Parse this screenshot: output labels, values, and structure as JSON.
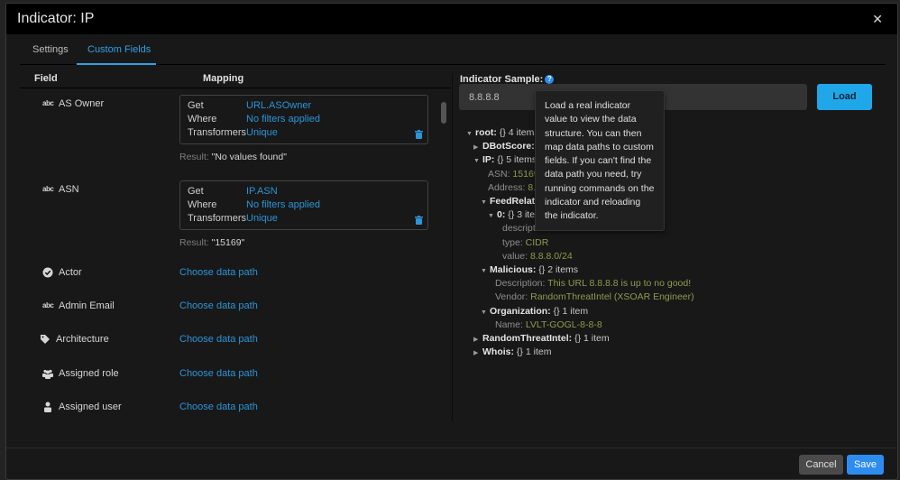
{
  "dialog": {
    "title": "Indicator: IP",
    "close_icon": "close-icon"
  },
  "tabs": [
    {
      "label": "Settings",
      "active": false
    },
    {
      "label": "Custom Fields",
      "active": true
    }
  ],
  "columns": {
    "field": "Field",
    "mapping": "Mapping"
  },
  "mapping_labels": {
    "get": "Get",
    "where": "Where",
    "transformers": "Transformers",
    "result": "Result:"
  },
  "fields": [
    {
      "name": "AS Owner",
      "icon": "text-type-icon",
      "mapped": true,
      "get": "URL.ASOwner",
      "where": "No filters applied",
      "transformers": "Unique",
      "result": "\"No values found\""
    },
    {
      "name": "ASN",
      "icon": "text-type-icon",
      "mapped": true,
      "get": "IP.ASN",
      "where": "No filters applied",
      "transformers": "Unique",
      "result": "\"15169\""
    },
    {
      "name": "Actor",
      "icon": "check-circle-icon",
      "mapped": false,
      "action": "Choose data path"
    },
    {
      "name": "Admin Email",
      "icon": "text-type-icon",
      "mapped": false,
      "action": "Choose data path"
    },
    {
      "name": "Architecture",
      "icon": "tag-icon",
      "mapped": false,
      "action": "Choose data path"
    },
    {
      "name": "Assigned role",
      "icon": "users-icon",
      "mapped": false,
      "action": "Choose data path"
    },
    {
      "name": "Assigned user",
      "icon": "user-icon",
      "mapped": false,
      "action": "Choose data path"
    }
  ],
  "sample": {
    "label": "Indicator Sample:",
    "value": "8.8.8.8",
    "load_label": "Load",
    "tooltip": "Load a real indicator value to view the data structure. You can then map data paths to custom fields. If you can't find the data path you need, try running commands on the indicator and reloading the indicator."
  },
  "tree": [
    {
      "key": "root:",
      "type": "{} 4 items",
      "expanded": true,
      "depth": 0,
      "bold": true
    },
    {
      "key": "DBotScore:",
      "type": "",
      "expanded": false,
      "depth": 1,
      "bold": true
    },
    {
      "key": "IP:",
      "type": "{} 5 items",
      "expanded": true,
      "depth": 1,
      "bold": true
    },
    {
      "key": "ASN:",
      "value": "15169",
      "depth": 2,
      "bold": false
    },
    {
      "key": "Address:",
      "value": "8.8.8.8",
      "depth": 2,
      "bold": false
    },
    {
      "key": "FeedRelatedIndicators:",
      "type": "",
      "expanded": true,
      "depth": 2,
      "bold": true
    },
    {
      "key": "0:",
      "type": "{} 3 items",
      "expanded": true,
      "depth": 3,
      "bold": true
    },
    {
      "key": "description:",
      "value": "null",
      "depth": 4,
      "bold": false
    },
    {
      "key": "type:",
      "value": "CIDR",
      "depth": 4,
      "bold": false
    },
    {
      "key": "value:",
      "value": "8.8.8.0/24",
      "depth": 4,
      "bold": false
    },
    {
      "key": "Malicious:",
      "type": "{} 2 items",
      "expanded": true,
      "depth": 2,
      "bold": true
    },
    {
      "key": "Description:",
      "value": "This URL 8.8.8.8 is up to no good!",
      "depth": 3,
      "bold": false
    },
    {
      "key": "Vendor:",
      "value": "RandomThreatIntel (XSOAR Engineer)",
      "depth": 3,
      "bold": false
    },
    {
      "key": "Organization:",
      "type": "{} 1 item",
      "expanded": true,
      "depth": 2,
      "bold": true
    },
    {
      "key": "Name:",
      "value": "LVLT-GOGL-8-8-8",
      "depth": 3,
      "bold": false
    },
    {
      "key": "RandomThreatIntel:",
      "type": "{} 1 item",
      "expanded": false,
      "depth": 1,
      "bold": true
    },
    {
      "key": "Whois:",
      "type": "{} 1 item",
      "expanded": false,
      "depth": 1,
      "bold": true
    }
  ],
  "footer": {
    "cancel_label": "Cancel",
    "save_label": "Save"
  },
  "colors": {
    "accent": "#2fa1e6",
    "link": "#2b95d8",
    "load_button": "#1fa7ea",
    "save_button": "#2d8cf0",
    "tree_value": "#8f9a4d"
  }
}
